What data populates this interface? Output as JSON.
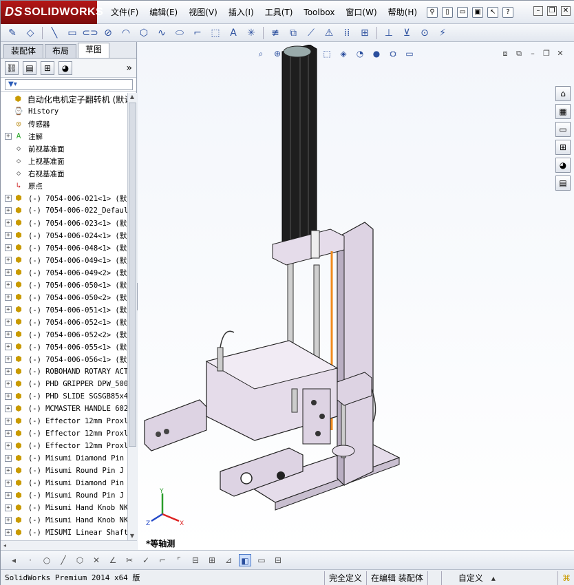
{
  "app": {
    "brand": "SOLIDWORKS",
    "brand_prefix": "DS"
  },
  "menu": [
    "文件(F)",
    "编辑(E)",
    "视图(V)",
    "插入(I)",
    "工具(T)",
    "Toolbox",
    "窗口(W)",
    "帮助(H)"
  ],
  "tabs": [
    "装配体",
    "布局",
    "草图"
  ],
  "active_tab": "草图",
  "tree": {
    "root": "自动化电机定子翻转机 (默认",
    "features": [
      {
        "label": "History",
        "icon": "history-icon"
      },
      {
        "label": "传感器",
        "icon": "sensor-icon"
      },
      {
        "label": "注解",
        "icon": "annotation-icon"
      },
      {
        "label": "前视基准面",
        "icon": "plane-icon"
      },
      {
        "label": "上视基准面",
        "icon": "plane-icon"
      },
      {
        "label": "右视基准面",
        "icon": "plane-icon"
      },
      {
        "label": "原点",
        "icon": "origin-icon"
      }
    ],
    "parts": [
      "(-) 7054-006-021<1> (默",
      "(-) 7054-006-022_Defaul",
      "(-) 7054-006-023<1> (默",
      "(-) 7054-006-024<1> (默",
      "(-) 7054-006-048<1> (默",
      "(-) 7054-006-049<1> (默",
      "(-) 7054-006-049<2> (默",
      "(-) 7054-006-050<1> (默",
      "(-) 7054-006-050<2> (默",
      "(-) 7054-006-051<1> (默",
      "(-) 7054-006-052<1> (默",
      "(-) 7054-006-052<2> (默",
      "(-) 7054-006-055<1> (默",
      "(-) 7054-006-056<1> (默",
      "(-) ROBOHAND ROTARY ACT",
      "(-) PHD GRIPPER DPW_500",
      "(-) PHD SLIDE SGSGB85x4",
      "(-) MCMASTER HANDLE 602",
      "(-) Effector 12mm Proxl",
      "(-) Effector 12mm Proxl",
      "(-) Effector 12mm Proxl",
      "(-) Misumi Diamond Pin",
      "(-) Misumi  Round Pin J",
      "(-) Misumi Diamond Pin",
      "(-) Misumi  Round Pin J",
      "(-) Misumi Hand Knob NK",
      "(-) Misumi Hand Knob NK",
      "(-) MISUMI Linear Shaft"
    ]
  },
  "viewport": {
    "view_name": "*等轴测",
    "triad": {
      "x": "X",
      "y": "Y",
      "z": "Z"
    }
  },
  "status": {
    "product": "SolidWorks Premium 2014 x64 版",
    "definition": "完全定义",
    "mode": "在编辑 装配体",
    "units": "自定义"
  },
  "colors": {
    "accent": "#b51717",
    "model_frame": "#ddd3e3",
    "model_dark": "#1e1e1e",
    "model_orange": "#f08a1c"
  }
}
